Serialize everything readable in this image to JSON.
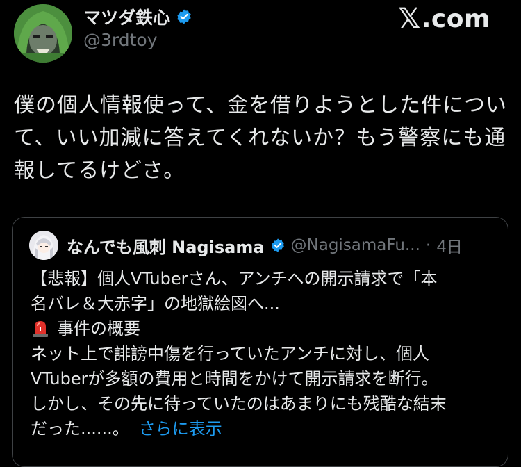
{
  "author": {
    "display_name": "マツダ鉄心",
    "handle": "@3rdtoy"
  },
  "brand": {
    "x_glyph": "𝕏",
    "suffix": ".com"
  },
  "tweet": {
    "lines": [
      "僕の個人情報使って、金を借りようとした件につい",
      "て、いい加減に答えてくれないか？もう警察にも通",
      "報してるけどさ。"
    ]
  },
  "quote": {
    "display_name": "なんでも風刺 Nagisama",
    "handle": "@NagisamaFu...",
    "separator": "·",
    "time": "4日",
    "lines": [
      "【悲報】個人VTuberさん、アンチへの開示請求で「本",
      "名バレ＆大赤字」の地獄絵図へ...",
      "事件の概要",
      "ネット上で誹謗中傷を行っていたアンチに対し、個人",
      "VTuberが多額の費用と時間をかけて開示請求を断行。",
      "しかし、その先に待っていたのはあまりにも残酷な結末",
      "だった......。"
    ],
    "show_more": "さらに表示"
  },
  "colors": {
    "accent": "#1d9bf0",
    "muted": "#71767b",
    "text": "#e7e9ea",
    "background": "#000000"
  },
  "icons": [
    "verified-badge-icon",
    "siren-icon"
  ]
}
